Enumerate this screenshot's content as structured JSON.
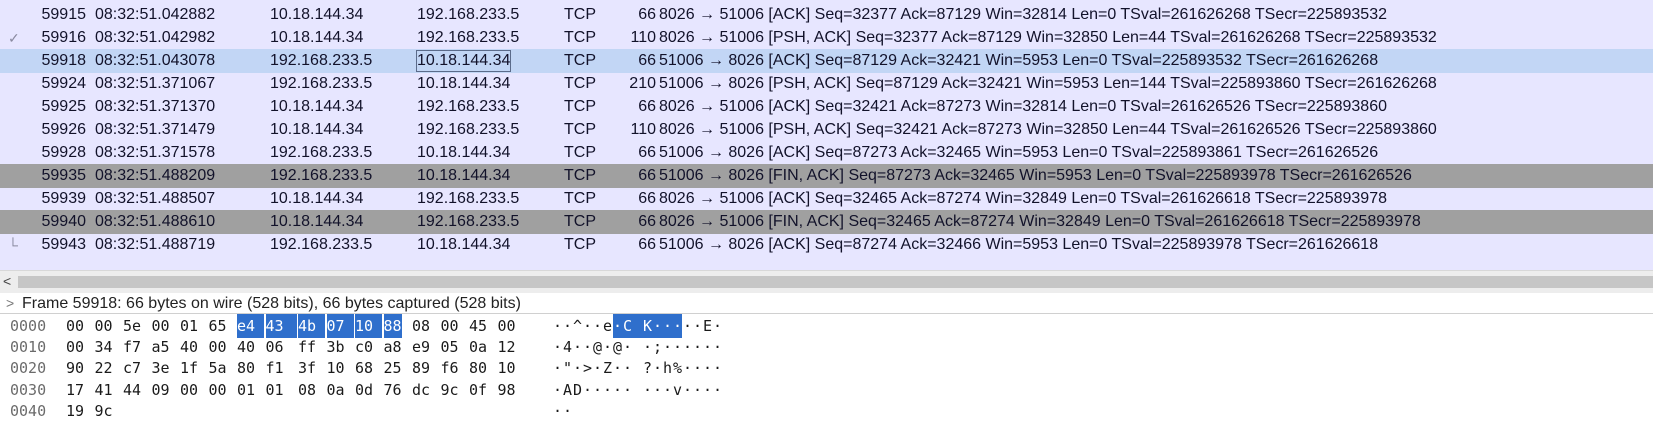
{
  "packets": [
    {
      "no": "59915",
      "time": "08:32:51.042882",
      "src": "10.18.144.34",
      "dst": "192.168.233.5",
      "proto": "TCP",
      "len": "66",
      "info": "8026 → 51006 [ACK] Seq=32377 Ack=87129 Win=32814 Len=0 TSval=261626268 TSecr=225893532",
      "style": "normal",
      "tree": ""
    },
    {
      "no": "59916",
      "time": "08:32:51.042982",
      "src": "10.18.144.34",
      "dst": "192.168.233.5",
      "proto": "TCP",
      "len": "110",
      "info": "8026 → 51006 [PSH, ACK] Seq=32377 Ack=87129 Win=32850 Len=44 TSval=261626268 TSecr=225893532",
      "style": "normal",
      "tree": "✓"
    },
    {
      "no": "59918",
      "time": "08:32:51.043078",
      "src": "192.168.233.5",
      "dst": "10.18.144.34",
      "proto": "TCP",
      "len": "66",
      "info": "51006 → 8026 [ACK] Seq=87129 Ack=32421 Win=5953 Len=0 TSval=225893532 TSecr=261626268",
      "style": "selected",
      "tree": ""
    },
    {
      "no": "59924",
      "time": "08:32:51.371067",
      "src": "192.168.233.5",
      "dst": "10.18.144.34",
      "proto": "TCP",
      "len": "210",
      "info": "51006 → 8026 [PSH, ACK] Seq=87129 Ack=32421 Win=5953 Len=144 TSval=225893860 TSecr=261626268",
      "style": "normal",
      "tree": ""
    },
    {
      "no": "59925",
      "time": "08:32:51.371370",
      "src": "10.18.144.34",
      "dst": "192.168.233.5",
      "proto": "TCP",
      "len": "66",
      "info": "8026 → 51006 [ACK] Seq=32421 Ack=87273 Win=32814 Len=0 TSval=261626526 TSecr=225893860",
      "style": "normal",
      "tree": ""
    },
    {
      "no": "59926",
      "time": "08:32:51.371479",
      "src": "10.18.144.34",
      "dst": "192.168.233.5",
      "proto": "TCP",
      "len": "110",
      "info": "8026 → 51006 [PSH, ACK] Seq=32421 Ack=87273 Win=32850 Len=44 TSval=261626526 TSecr=225893860",
      "style": "normal",
      "tree": ""
    },
    {
      "no": "59928",
      "time": "08:32:51.371578",
      "src": "192.168.233.5",
      "dst": "10.18.144.34",
      "proto": "TCP",
      "len": "66",
      "info": "51006 → 8026 [ACK] Seq=87273 Ack=32465 Win=5953 Len=0 TSval=225893861 TSecr=261626526",
      "style": "normal",
      "tree": ""
    },
    {
      "no": "59935",
      "time": "08:32:51.488209",
      "src": "192.168.233.5",
      "dst": "10.18.144.34",
      "proto": "TCP",
      "len": "66",
      "info": "51006 → 8026 [FIN, ACK] Seq=87273 Ack=32465 Win=5953 Len=0 TSval=225893978 TSecr=261626526",
      "style": "fin",
      "tree": ""
    },
    {
      "no": "59939",
      "time": "08:32:51.488507",
      "src": "10.18.144.34",
      "dst": "192.168.233.5",
      "proto": "TCP",
      "len": "66",
      "info": "8026 → 51006 [ACK] Seq=32465 Ack=87274 Win=32849 Len=0 TSval=261626618 TSecr=225893978",
      "style": "normal",
      "tree": ""
    },
    {
      "no": "59940",
      "time": "08:32:51.488610",
      "src": "10.18.144.34",
      "dst": "192.168.233.5",
      "proto": "TCP",
      "len": "66",
      "info": "8026 → 51006 [FIN, ACK] Seq=32465 Ack=87274 Win=32849 Len=0 TSval=261626618 TSecr=225893978",
      "style": "fin",
      "tree": ""
    },
    {
      "no": "59943",
      "time": "08:32:51.488719",
      "src": "192.168.233.5",
      "dst": "10.18.144.34",
      "proto": "TCP",
      "len": "66",
      "info": "51006 → 8026 [ACK] Seq=87274 Ack=32466 Win=5953 Len=0 TSval=225893978 TSecr=261626618",
      "style": "normal",
      "tree": "└"
    }
  ],
  "scrollbar": {
    "left_arrow": "<"
  },
  "detail": {
    "twisty": ">",
    "text": "Frame 59918: 66 bytes on wire (528 bits), 66 bytes captured (528 bits)"
  },
  "bytes": [
    {
      "offset": "0000",
      "hex": [
        "00",
        "00",
        "5e",
        "00",
        "01",
        "65",
        "e4",
        "43",
        "4b",
        "07",
        "10",
        "88",
        "08",
        "00",
        "45",
        "00"
      ],
      "ascii": [
        "·",
        "·",
        "^",
        "·",
        "·",
        "e",
        "·",
        "C",
        "K",
        "·",
        "·",
        "·",
        "·",
        "·",
        "E",
        "·"
      ],
      "highlight": [
        6,
        7,
        8,
        9,
        10,
        11
      ]
    },
    {
      "offset": "0010",
      "hex": [
        "00",
        "34",
        "f7",
        "a5",
        "40",
        "00",
        "40",
        "06",
        "ff",
        "3b",
        "c0",
        "a8",
        "e9",
        "05",
        "0a",
        "12"
      ],
      "ascii": [
        "·",
        "4",
        "·",
        "·",
        "@",
        "·",
        "@",
        "·",
        "·",
        ";",
        "·",
        "·",
        "·",
        "·",
        "·",
        "·"
      ],
      "highlight": []
    },
    {
      "offset": "0020",
      "hex": [
        "90",
        "22",
        "c7",
        "3e",
        "1f",
        "5a",
        "80",
        "f1",
        "3f",
        "10",
        "68",
        "25",
        "89",
        "f6",
        "80",
        "10"
      ],
      "ascii": [
        "·",
        "\"",
        "·",
        ">",
        "·",
        "Z",
        "·",
        "·",
        "?",
        "·",
        "h",
        "%",
        "·",
        "·",
        "·",
        "·"
      ],
      "highlight": []
    },
    {
      "offset": "0030",
      "hex": [
        "17",
        "41",
        "44",
        "09",
        "00",
        "00",
        "01",
        "01",
        "08",
        "0a",
        "0d",
        "76",
        "dc",
        "9c",
        "0f",
        "98"
      ],
      "ascii": [
        "·",
        "A",
        "D",
        "·",
        "·",
        "·",
        "·",
        "·",
        "·",
        "·",
        "·",
        "v",
        "·",
        "·",
        "·",
        "·"
      ],
      "highlight": []
    },
    {
      "offset": "0040",
      "hex": [
        "19",
        "9c"
      ],
      "ascii": [
        "·",
        "·"
      ],
      "highlight": []
    }
  ],
  "colors": {
    "list_bg": "#e7e6ff",
    "selected_bg": "#c2d6f5",
    "fin_bg": "#a0a0a0",
    "byte_highlight": "#2f6fcc"
  }
}
